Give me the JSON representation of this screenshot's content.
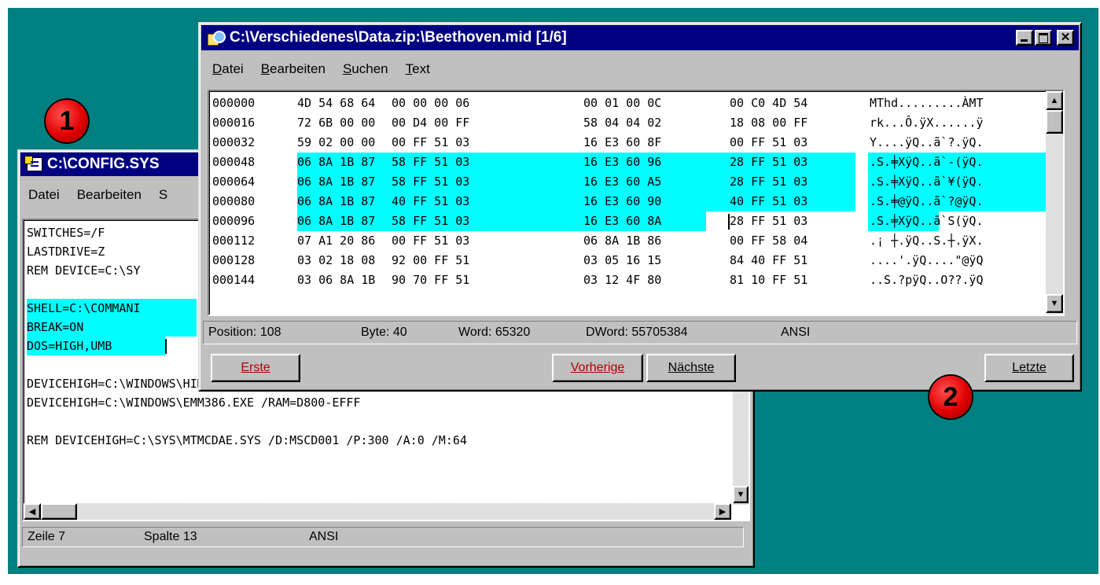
{
  "config_window": {
    "title": "C:\\CONFIG.SYS",
    "menu": [
      "Datei",
      "Bearbeiten",
      "S"
    ],
    "lines": [
      "SWITCHES=/F",
      "LASTDRIVE=Z",
      "REM DEVICE=C:\\SY",
      "",
      "SHELL=C:\\COMMANI",
      "BREAK=ON",
      "DOS=HIGH,UMB",
      "",
      "DEVICEHIGH=C:\\WINDOWS\\HIMEM.SYS /TESTMEM:OFF",
      "DEVICEHIGH=C:\\WINDOWS\\EMM386.EXE /RAM=D800-EFFF",
      "",
      "REM DEVICEHIGH=C:\\SYS\\MTMCDAE.SYS /D:MSCD001 /P:300 /A:0 /M:64"
    ],
    "status": {
      "line": "Zeile 7",
      "column": "Spalte 13",
      "encoding": "ANSI"
    },
    "badge": "1"
  },
  "hex_window": {
    "title": "C:\\Verschiedenes\\Data.zip:\\Beethoven.mid [1/6]",
    "menu": [
      "Datei",
      "Bearbeiten",
      "Suchen",
      "Text"
    ],
    "rows": [
      {
        "offset": "000000",
        "g1": "4D 54 68 64",
        "g2": "00 00 00 06",
        "g3": "00 01 00 0C",
        "g4": "00 C0 4D 54",
        "ascii": "MThd.........ÀMT"
      },
      {
        "offset": "000016",
        "g1": "72 6B 00 00",
        "g2": "00 D4 00 FF",
        "g3": "58 04 04 02",
        "g4": "18 08 00 FF",
        "ascii": "rk...Ô.ÿX......ÿ"
      },
      {
        "offset": "000032",
        "g1": "59 02 00 00",
        "g2": "00 FF 51 03",
        "g3": "16 E3 60 8F",
        "g4": "00 FF 51 03",
        "ascii": "Y....ÿQ..ã`?.ÿQ."
      },
      {
        "offset": "000048",
        "g1": "06 8A 1B 87",
        "g2": "58 FF 51 03",
        "g3": "16 E3 60 96",
        "g4": "28 FF 51 03",
        "ascii": ".S.╪XÿQ..ã`-(ÿQ."
      },
      {
        "offset": "000064",
        "g1": "06 8A 1B 87",
        "g2": "58 FF 51 03",
        "g3": "16 E3 60 A5",
        "g4": "28 FF 51 03",
        "ascii": ".S.╪XÿQ..ã`¥(ÿQ."
      },
      {
        "offset": "000080",
        "g1": "06 8A 1B 87",
        "g2": "40 FF 51 03",
        "g3": "16 E3 60 90",
        "g4": "40 FF 51 03",
        "ascii": ".S.╪@ÿQ..ã`?@ÿQ."
      },
      {
        "offset": "000096",
        "g1": "06 8A 1B 87",
        "g2": "58 FF 51 03",
        "g3": "16 E3 60 8A",
        "g4": "28 FF 51 03",
        "ascii": ".S.╪XÿQ..ã`S(ÿQ."
      },
      {
        "offset": "000112",
        "g1": "07 A1 20 86",
        "g2": "00 FF 51 03",
        "g3": "06 8A 1B 86",
        "g4": "00 FF 58 04",
        "ascii": ".¡ ┼.ÿQ..S.┼.ÿX."
      },
      {
        "offset": "000128",
        "g1": "03 02 18 08",
        "g2": "92 00 FF 51",
        "g3": "03 05 16 15",
        "g4": "84 40 FF 51",
        "ascii": "....'.ÿQ....\"@ÿQ"
      },
      {
        "offset": "000144",
        "g1": "03 06 8A 1B",
        "g2": "90 70 FF 51",
        "g3": "03 12 4F 80",
        "g4": "81 10 FF 51",
        "ascii": "..S.?pÿQ..O??.ÿQ"
      }
    ],
    "status": {
      "position": "Position: 108",
      "byte": "Byte: 40",
      "word": "Word: 65320",
      "dword": "DWord: 55705384",
      "encoding": "ANSI"
    },
    "buttons": {
      "first": "Erste",
      "prev": "Vorherige",
      "next": "Nächste",
      "last": "Letzte"
    },
    "badge": "2"
  },
  "colors": {
    "desktop": "#008080",
    "titlebar": "#000080",
    "highlight": "#00ffff",
    "badge": "#e00000"
  }
}
